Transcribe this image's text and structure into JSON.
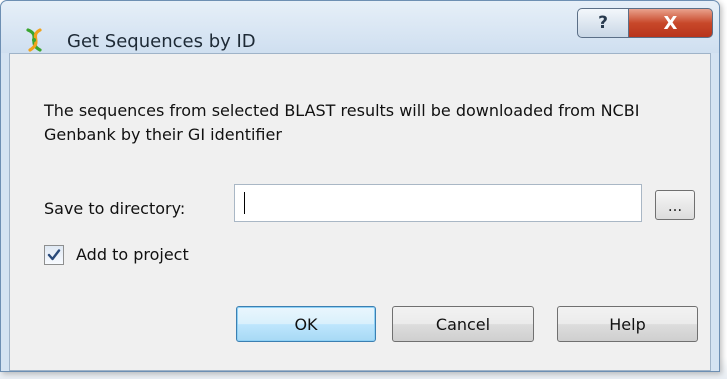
{
  "window": {
    "title": "Get Sequences by ID",
    "help_glyph": "?",
    "close_glyph": "X"
  },
  "dialog": {
    "description": "The sequences from selected BLAST results will be downloaded from NCBI Genbank by their GI identifier",
    "directory_label": "Save to directory:",
    "directory_value": "",
    "browse_label": "...",
    "add_to_project_label": "Add to project",
    "add_to_project_checked": true,
    "ok_label": "OK",
    "cancel_label": "Cancel",
    "help_label": "Help"
  },
  "icons": {
    "app": "ugene-helix-icon",
    "check": "checkmark-icon"
  },
  "colors": {
    "close_button": "#c8482a",
    "default_button_border": "#3c7fb1",
    "dialog_background": "#f0f0f0"
  }
}
